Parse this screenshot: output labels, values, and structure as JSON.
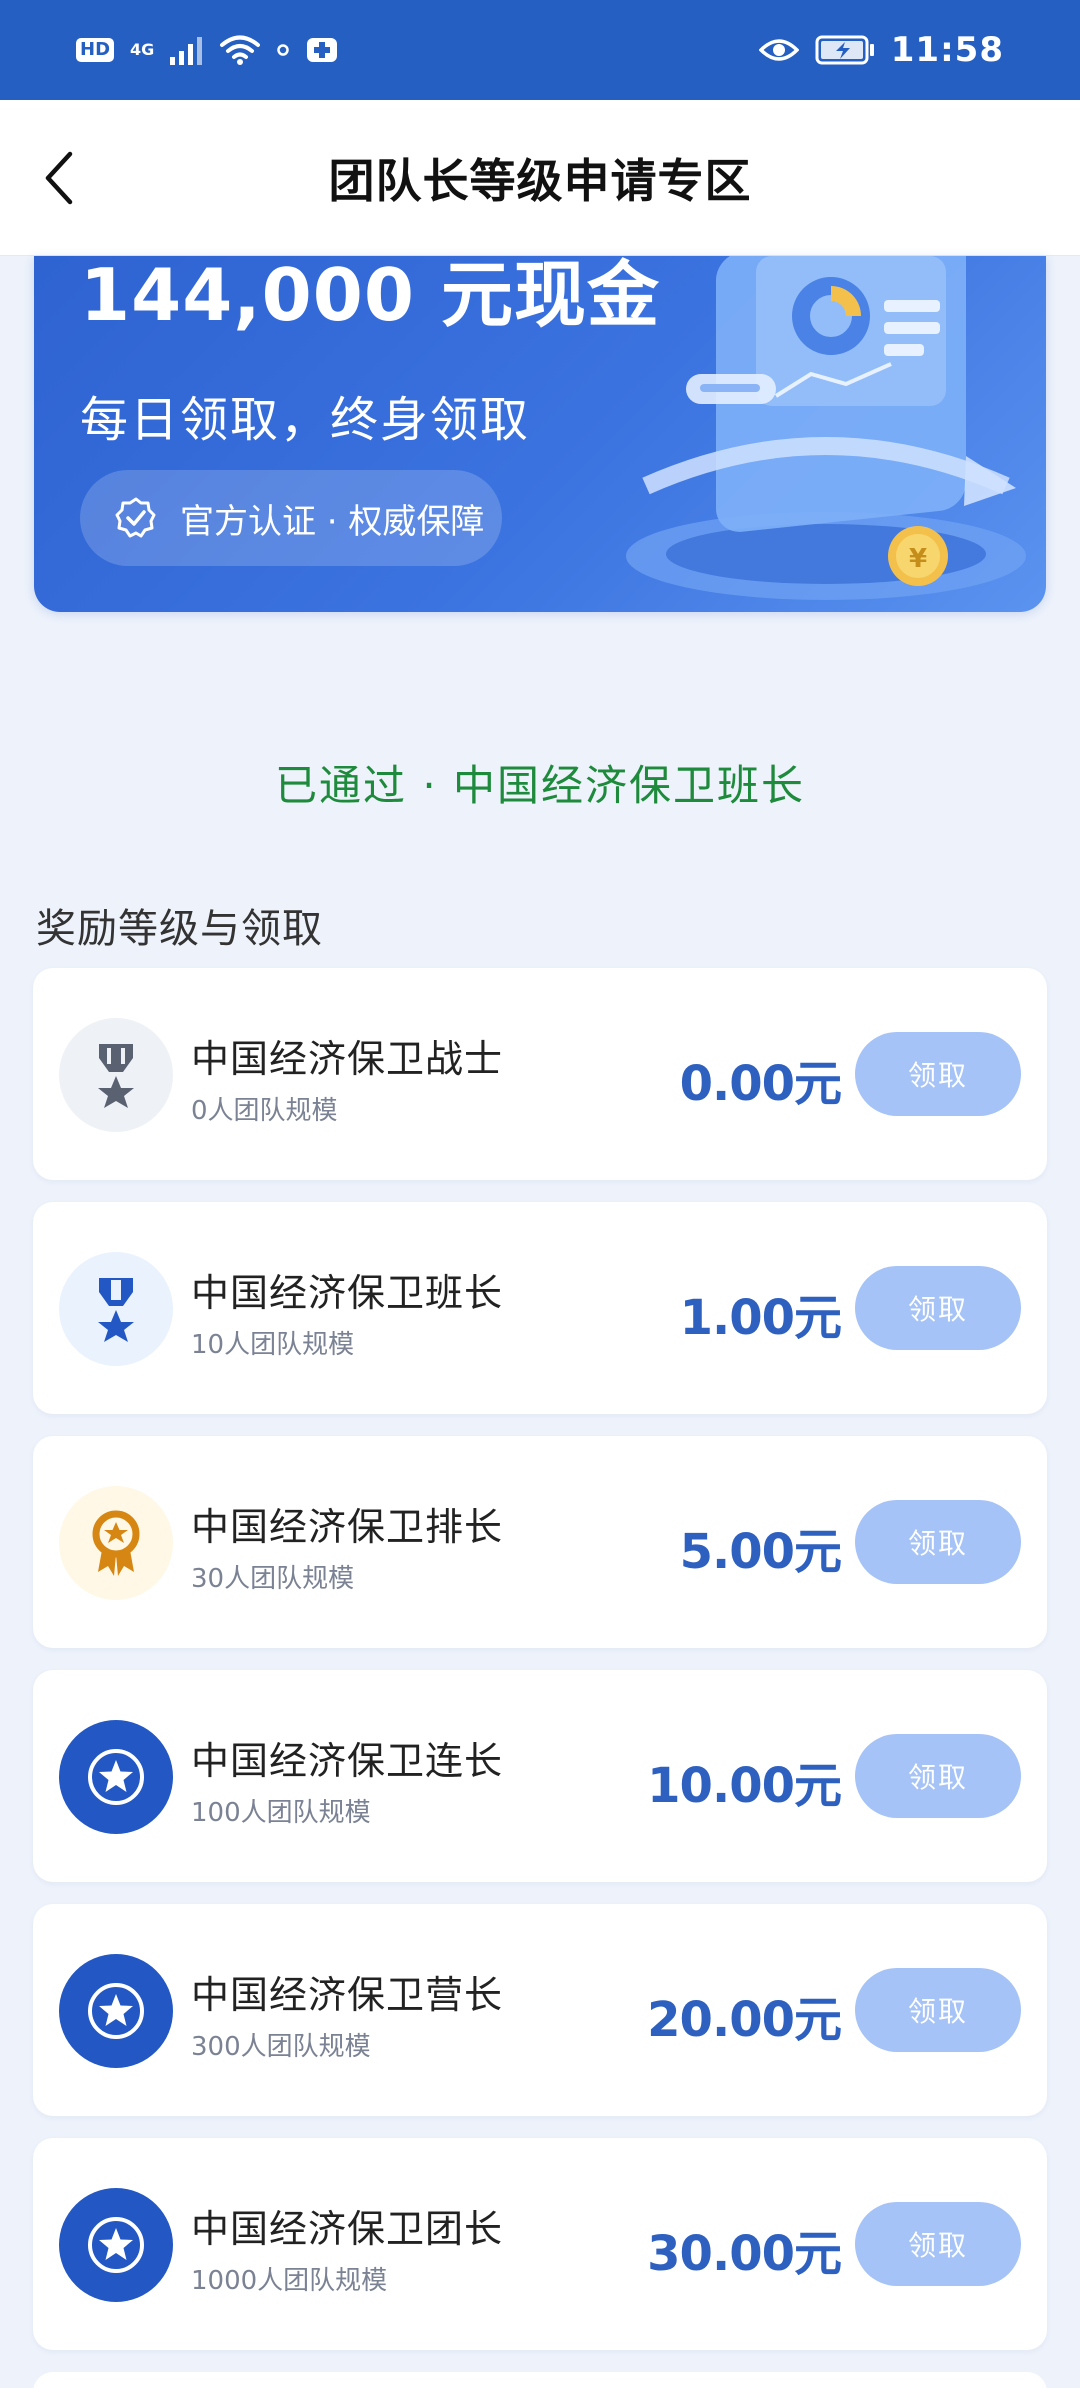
{
  "status_bar": {
    "hd": "HD",
    "net": "4G",
    "time": "11:58"
  },
  "header": {
    "title": "团队长等级申请专区"
  },
  "banner": {
    "amount": "144,000 元现金",
    "subtitle": "每日领取，终身领取",
    "badge": "官方认证 · 权威保障"
  },
  "status_text": "已通过 · 中国经济保卫班长",
  "section_title": "奖励等级与领取",
  "levels": [
    {
      "name": "中国经济保卫战士",
      "size": "0人团队规模",
      "amount": "0.00元",
      "button": "领取",
      "icon": "medal-gray-icon"
    },
    {
      "name": "中国经济保卫班长",
      "size": "10人团队规模",
      "amount": "1.00元",
      "button": "领取",
      "icon": "medal-blue-icon"
    },
    {
      "name": "中国经济保卫排长",
      "size": "30人团队规模",
      "amount": "5.00元",
      "button": "领取",
      "icon": "medal-gold-icon"
    },
    {
      "name": "中国经济保卫连长",
      "size": "100人团队规模",
      "amount": "10.00元",
      "button": "领取",
      "icon": "star-badge-icon"
    },
    {
      "name": "中国经济保卫营长",
      "size": "300人团队规模",
      "amount": "20.00元",
      "button": "领取",
      "icon": "star-badge-icon"
    },
    {
      "name": "中国经济保卫团长",
      "size": "1000人团队规模",
      "amount": "30.00元",
      "button": "领取",
      "icon": "star-badge-icon"
    }
  ],
  "colors": {
    "status_bar": "#245FC1",
    "approved": "#1E8A3C",
    "amount": "#2E60C0",
    "claim_button": "#A5C3F7",
    "star_badge": "#2257C4"
  }
}
